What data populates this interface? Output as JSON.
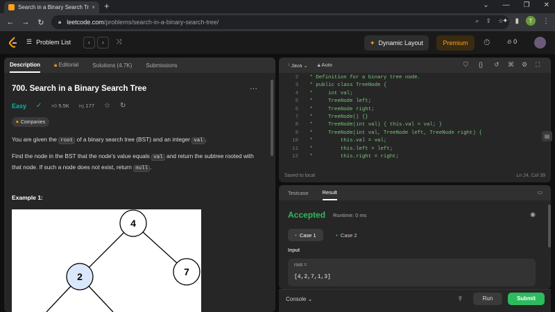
{
  "browser": {
    "tab_title": "Search in a Binary Search Tree - L",
    "tab_close": "×",
    "new_tab": "+",
    "url_host": "leetcode.com",
    "url_path": "/problems/search-in-a-binary-search-tree/",
    "profile_initial": "T",
    "window_controls": [
      "⌄",
      "—",
      "❐",
      "✕"
    ]
  },
  "lc_nav": {
    "problem_list": "Problem List",
    "dynamic_layout": "Dynamic Layout",
    "premium": "Premium",
    "streak": "0"
  },
  "left_tabs": [
    "Description",
    "Editorial",
    "Solutions (4.7K)",
    "Submissions"
  ],
  "problem": {
    "title": "700. Search in a Binary Search Tree",
    "difficulty": "Easy",
    "likes": "5.5K",
    "dislikes": "177",
    "companies": "Companies",
    "p1_a": "You are given the ",
    "p1_code1": "root",
    "p1_b": " of a binary search tree (BST) and an integer ",
    "p1_code2": "val",
    "p1_c": ".",
    "p2_a": "Find the node in the BST that the node's value equals ",
    "p2_code1": "val",
    "p2_b": " and return the subtree rooted with that node. If such a node does not exist, return ",
    "p2_code2": "null",
    "p2_c": ".",
    "example_title": "Example 1:",
    "tree_nodes": [
      "4",
      "2",
      "7"
    ]
  },
  "editor": {
    "language": "Java",
    "mode": "Auto",
    "lines": [
      {
        "n": "2",
        "t": " * Definition for a binary tree node."
      },
      {
        "n": "3",
        "t": " * public class TreeNode {"
      },
      {
        "n": "4",
        "t": " *     int val;"
      },
      {
        "n": "5",
        "t": " *     TreeNode left;"
      },
      {
        "n": "6",
        "t": " *     TreeNode right;"
      },
      {
        "n": "7",
        "t": " *     TreeNode() {}"
      },
      {
        "n": "8",
        "t": " *     TreeNode(int val) { this.val = val; }"
      },
      {
        "n": "9",
        "t": " *     TreeNode(int val, TreeNode left, TreeNode right) {"
      },
      {
        "n": "10",
        "t": " *         this.val = val;"
      },
      {
        "n": "11",
        "t": " *         this.left = left;"
      },
      {
        "n": "12",
        "t": " *         this.right = right;"
      }
    ],
    "saved": "Saved to local",
    "position": "Ln 24, Col 39"
  },
  "result": {
    "tabs": [
      "Testcase",
      "Result"
    ],
    "status": "Accepted",
    "runtime": "Runtime: 0 ms",
    "cases": [
      "Case 1",
      "Case 2"
    ],
    "input_label": "Input",
    "var_name": "root =",
    "var_value": "[4,2,7,1,3]"
  },
  "footer": {
    "console": "Console",
    "run": "Run",
    "submit": "Submit"
  },
  "colors": {
    "accent": "#ffa116",
    "accepted": "#2cbb5d",
    "easy": "#00b8a3"
  }
}
